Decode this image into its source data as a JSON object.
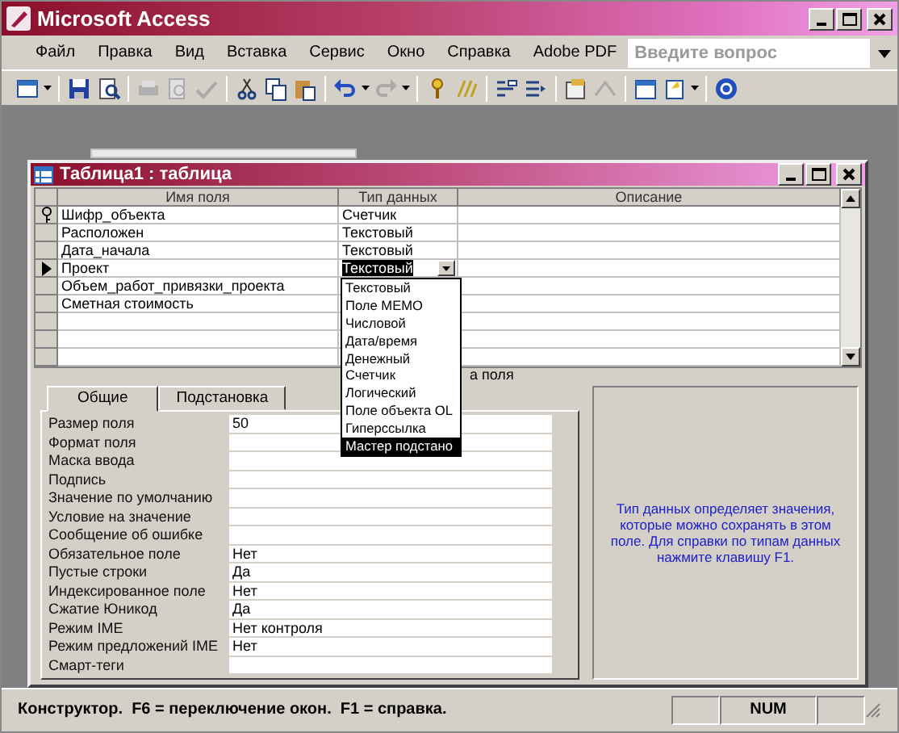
{
  "app": {
    "title": "Microsoft Access"
  },
  "menu": [
    "Файл",
    "Правка",
    "Вид",
    "Вставка",
    "Сервис",
    "Окно",
    "Справка",
    "Adobe PDF"
  ],
  "question_box": {
    "placeholder": "Введите вопрос"
  },
  "table_window": {
    "title": "Таблица1 : таблица",
    "columns": [
      "Имя поля",
      "Тип данных",
      "Описание"
    ],
    "rows": [
      {
        "name": "Шифр_объекта",
        "type": "Счетчик",
        "key": true,
        "current": false
      },
      {
        "name": "Расположен",
        "type": "Текстовый",
        "key": false,
        "current": false
      },
      {
        "name": "Дата_начала",
        "type": "Текстовый",
        "key": false,
        "current": false
      },
      {
        "name": "Проект",
        "type": "Текстовый",
        "key": false,
        "current": true
      },
      {
        "name": "Объем_работ_привязки_проекта",
        "key": false,
        "current": false
      },
      {
        "name": "Сметная стоимость",
        "key": false,
        "current": false
      }
    ],
    "type_dropdown": [
      {
        "label": "Текстовый",
        "selected": false
      },
      {
        "label": "Поле MEMO",
        "selected": false
      },
      {
        "label": "Числовой",
        "selected": false
      },
      {
        "label": "Дата/время",
        "selected": false
      },
      {
        "label": "Денежный",
        "selected": false
      },
      {
        "label": "Счетчик",
        "selected": false
      },
      {
        "label": "Логический",
        "selected": false
      },
      {
        "label": "Поле объекта OL",
        "selected": false
      },
      {
        "label": "Гиперссылка",
        "selected": false
      },
      {
        "label": "Мастер подстано",
        "selected": true
      }
    ],
    "section_hint": "а поля",
    "tabs": [
      {
        "label": "Общие",
        "selected": true
      },
      {
        "label": "Подстановка",
        "selected": false
      }
    ],
    "properties": [
      {
        "label": "Размер поля",
        "value": "50"
      },
      {
        "label": "Формат поля"
      },
      {
        "label": "Маска ввода"
      },
      {
        "label": "Подпись"
      },
      {
        "label": "Значение по умолчанию"
      },
      {
        "label": "Условие на значение"
      },
      {
        "label": "Сообщение об ошибке"
      },
      {
        "label": "Обязательное поле",
        "value": "Нет"
      },
      {
        "label": "Пустые строки",
        "value": "Да"
      },
      {
        "label": "Индексированное поле",
        "value": "Нет"
      },
      {
        "label": "Сжатие Юникод",
        "value": "Да"
      },
      {
        "label": "Режим IME",
        "value": "Нет контроля"
      },
      {
        "label": "Режим предложений IME",
        "value": "Нет"
      },
      {
        "label": "Смарт-теги"
      }
    ],
    "help_text": "Тип данных определяет значения, которые можно сохранять в этом поле.  Для справки по типам данных нажмите клавишу F1."
  },
  "status_bar": {
    "text": "Конструктор.  F6 = переключение окон.  F1 = справка.",
    "indicator": "NUM"
  }
}
